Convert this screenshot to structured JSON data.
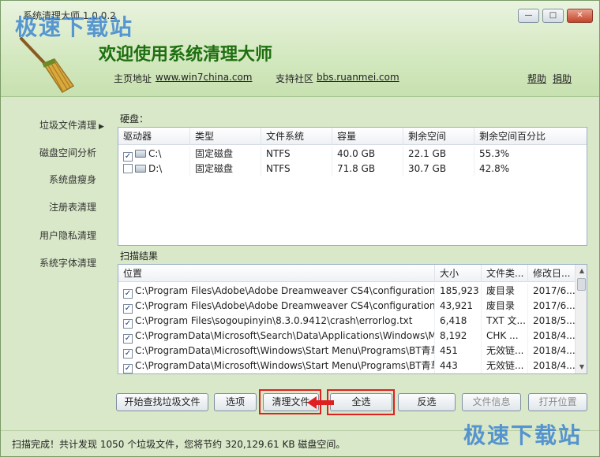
{
  "window": {
    "title": "系统清理大师 1.0.0.2",
    "watermark": "极速下载站"
  },
  "header": {
    "welcome": "欢迎使用系统清理大师",
    "home_label": "主页地址",
    "home_url": "www.win7china.com",
    "community_label": "支持社区",
    "community_url": "bbs.ruanmei.com",
    "help": "帮助",
    "donate": "捐助"
  },
  "sidebar": {
    "items": [
      {
        "label": "垃圾文件清理",
        "arrow": "▶"
      },
      {
        "label": "磁盘空间分析"
      },
      {
        "label": "系统盘瘦身"
      },
      {
        "label": "注册表清理"
      },
      {
        "label": "用户隐私清理"
      },
      {
        "label": "系统字体清理"
      }
    ]
  },
  "disks": {
    "label": "硬盘：",
    "columns": [
      "驱动器",
      "类型",
      "文件系统",
      "容量",
      "剩余空间",
      "剩余空间百分比"
    ],
    "rows": [
      {
        "checked": "✓",
        "drive": "C:\\",
        "type": "固定磁盘",
        "fs": "NTFS",
        "capacity": "40.0 GB",
        "free": "22.1 GB",
        "percent": "55.3%"
      },
      {
        "checked": "",
        "drive": "D:\\",
        "type": "固定磁盘",
        "fs": "NTFS",
        "capacity": "71.8 GB",
        "free": "30.7 GB",
        "percent": "42.8%"
      }
    ]
  },
  "results": {
    "label": "扫描结果",
    "columns": [
      "位置",
      "大小",
      "文件类...",
      "修改日..."
    ],
    "rows": [
      {
        "checked": "✓",
        "path": "C:\\Program Files\\Adobe\\Adobe Dreamweaver CS4\\configuration\\Be...",
        "size": "185,923",
        "type": "废目录",
        "date": "2017/6..."
      },
      {
        "checked": "✓",
        "path": "C:\\Program Files\\Adobe\\Adobe Dreamweaver CS4\\configuration\\Sni...",
        "size": "43,921",
        "type": "废目录",
        "date": "2017/6..."
      },
      {
        "checked": "✓",
        "path": "C:\\Program Files\\sogoupinyin\\8.3.0.9412\\crash\\errorlog.txt",
        "size": "6,418",
        "type": "TXT 文...",
        "date": "2018/5..."
      },
      {
        "checked": "✓",
        "path": "C:\\ProgramData\\Microsoft\\Search\\Data\\Applications\\Windows\\MSS...",
        "size": "8,192",
        "type": "CHK ...",
        "date": "2018/4..."
      },
      {
        "checked": "✓",
        "path": "C:\\ProgramData\\Microsoft\\Windows\\Start Menu\\Programs\\BT青草\\...",
        "size": "451",
        "type": "无效链...",
        "date": "2018/4..."
      },
      {
        "checked": "✓",
        "path": "C:\\ProgramData\\Microsoft\\Windows\\Start Menu\\Programs\\BT青草\\...",
        "size": "443",
        "type": "无效链...",
        "date": "2018/4..."
      }
    ]
  },
  "buttons": {
    "start_scan": "开始查找垃圾文件",
    "options": "选项",
    "clean": "清理文件",
    "select_all": "全选",
    "invert": "反选",
    "file_info": "文件信息",
    "open_location": "打开位置"
  },
  "status": "扫描完成！共计发现 1050 个垃圾文件，您将节约 320,129.61 KB 磁盘空间。",
  "colors": {
    "accent_green": "#1e6f10",
    "highlight_red": "#e02020"
  }
}
